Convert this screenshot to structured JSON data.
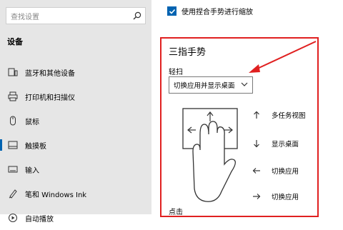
{
  "sidebar": {
    "search_placeholder": "查找设置",
    "section_title": "设备",
    "items": [
      {
        "label": "蓝牙和其他设备",
        "icon": "bluetooth-device-icon"
      },
      {
        "label": "打印机和扫描仪",
        "icon": "printer-icon"
      },
      {
        "label": "鼠标",
        "icon": "mouse-icon"
      },
      {
        "label": "触摸板",
        "icon": "touchpad-icon",
        "selected": true
      },
      {
        "label": "输入",
        "icon": "keyboard-icon"
      },
      {
        "label": "笔和 Windows Ink",
        "icon": "pen-icon"
      },
      {
        "label": "自动播放",
        "icon": "autoplay-icon"
      }
    ]
  },
  "main": {
    "pinch_zoom_label": "使用捏合手势进行缩放",
    "pinch_zoom_checked": true,
    "three_finger_heading": "三指手势",
    "swipe_label": "轻扫",
    "swipe_value": "切换应用并显示桌面",
    "gestures": [
      {
        "direction": "up",
        "label": "多任务视图"
      },
      {
        "direction": "down",
        "label": "显示桌面"
      },
      {
        "direction": "left",
        "label": "切换应用"
      },
      {
        "direction": "right",
        "label": "切换应用"
      }
    ],
    "tap_label": "点击"
  },
  "colors": {
    "accent": "#0063b1",
    "highlight": "#e02020",
    "sidebar_bg": "#e6e6e6"
  }
}
